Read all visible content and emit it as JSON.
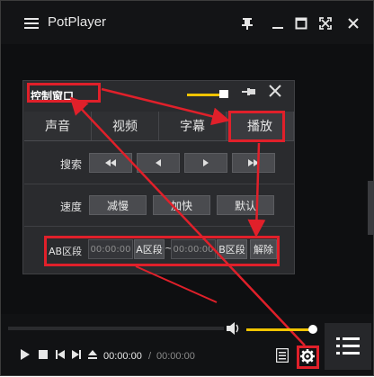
{
  "app": {
    "title": "PotPlayer"
  },
  "panel": {
    "title": "控制窗口",
    "tabs": [
      "声音",
      "视频",
      "字幕",
      "播放"
    ],
    "rows": {
      "search": {
        "label": "搜索",
        "buttons": [
          "⏪",
          "◀",
          "▶",
          "⏩"
        ]
      },
      "speed": {
        "label": "速度",
        "buttons": [
          "减慢",
          "加快",
          "默认"
        ]
      },
      "ab": {
        "label": "AB区段",
        "time_a": "00:00:00",
        "btn_a": "A区段",
        "tilde": "~",
        "time_b": "00:00:00",
        "btn_b": "B区段",
        "release": "解除"
      }
    }
  },
  "player": {
    "current_time": "00:00:00",
    "separator": "/",
    "total_time": "00:00:00"
  },
  "colors": {
    "accent": "#f0c400",
    "annotation": "#e0202a",
    "background": "#111214"
  },
  "icons": {
    "menu": "hamburger-icon",
    "pin": "pin-icon",
    "minimize": "minimize-icon",
    "maximize": "maximize-icon",
    "fullscreen": "fullscreen-icon",
    "close": "close-icon",
    "speaker": "speaker-icon",
    "playlist": "playlist-icon",
    "settings": "gear-icon"
  }
}
